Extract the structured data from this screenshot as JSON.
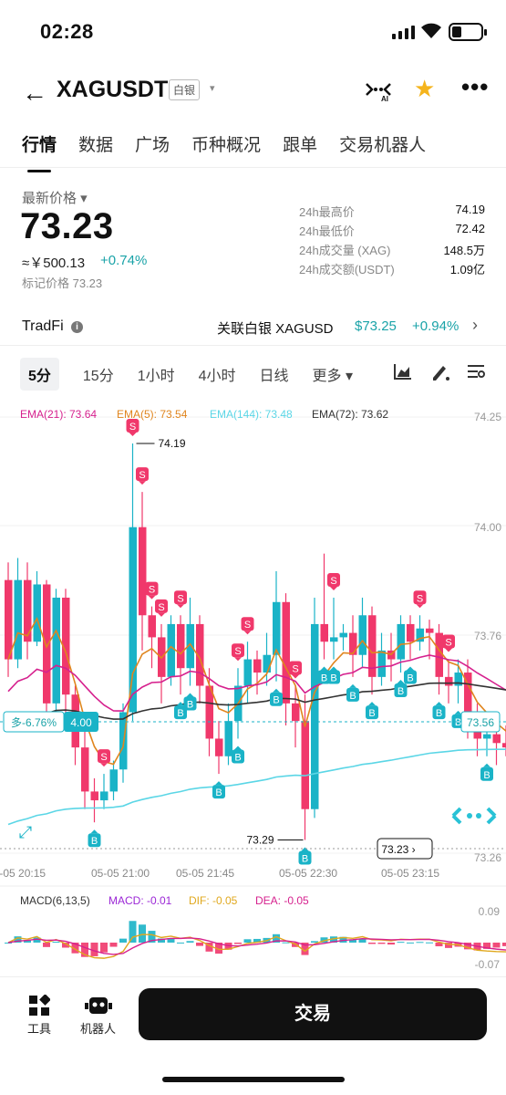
{
  "status_bar": {
    "time": "02:28"
  },
  "header": {
    "pair": "XAGUSDT",
    "tag": "白银",
    "caret": "▾",
    "ai_label": "AI"
  },
  "tabs": [
    "行情",
    "数据",
    "广场",
    "币种概况",
    "跟单",
    "交易机器人"
  ],
  "price": {
    "latest_label": "最新价格 ▾",
    "latest": "73.23",
    "cny": "≈￥500.13",
    "change_pct": "+0.74%",
    "mark": "标记价格 73.23"
  },
  "stats": [
    {
      "label": "24h最高价",
      "value": "74.19"
    },
    {
      "label": "24h最低价",
      "value": "72.42"
    },
    {
      "label": "24h成交量 (XAG)",
      "value": "148.5万"
    },
    {
      "label": "24h成交额(USDT)",
      "value": "1.09亿"
    }
  ],
  "tradfi": {
    "label": "TradFi",
    "linked": "关联白银 XAGUSD",
    "price": "$73.25",
    "pct": "+0.94%"
  },
  "intervals": [
    "5分",
    "15分",
    "1小时",
    "4小时",
    "日线",
    "更多 ▾"
  ],
  "chart_data": {
    "type": "candlestick",
    "ema_legend": [
      {
        "label": "EMA(21): 73.64",
        "color": "#d6218e"
      },
      {
        "label": "EMA(5): 73.54",
        "color": "#e0851e"
      },
      {
        "label": "EMA(144): 73.48",
        "color": "#5bd6e6"
      },
      {
        "label": "EMA(72): 73.62",
        "color": "#333333"
      }
    ],
    "y_ticks": [
      "74.25",
      "74.00",
      "73.76",
      "73.26"
    ],
    "x_ticks": [
      "05-05 20:15",
      "05-05 21:00",
      "05-05 21:45",
      "05-05 22:30",
      "05-05 23:15"
    ],
    "high_marker": "74.19",
    "low_marker": "73.29",
    "current_price_tag": "73.23",
    "right_price_tag": "73.56",
    "position_tag": {
      "label": "多-6.76%",
      "value": "4.00"
    },
    "candles": [
      [
        73.88,
        73.7,
        73.92,
        73.66
      ],
      [
        73.7,
        73.88,
        73.93,
        73.68
      ],
      [
        73.88,
        73.74,
        73.92,
        73.7
      ],
      [
        73.74,
        73.87,
        73.9,
        73.73
      ],
      [
        73.87,
        73.6,
        73.88,
        73.58
      ],
      [
        73.6,
        73.84,
        73.86,
        73.58
      ],
      [
        73.84,
        73.62,
        73.86,
        73.57
      ],
      [
        73.62,
        73.5,
        73.64,
        73.46
      ],
      [
        73.5,
        73.4,
        73.56,
        73.36
      ],
      [
        73.4,
        73.38,
        73.43,
        73.33
      ],
      [
        73.38,
        73.4,
        73.44,
        73.36
      ],
      [
        73.4,
        73.45,
        73.47,
        73.38
      ],
      [
        73.45,
        73.58,
        73.6,
        73.42
      ],
      [
        73.58,
        74.0,
        74.19,
        73.56
      ],
      [
        74.0,
        73.8,
        74.08,
        73.72
      ],
      [
        73.8,
        73.75,
        73.82,
        73.68
      ],
      [
        73.75,
        73.66,
        73.78,
        73.6
      ],
      [
        73.66,
        73.78,
        73.8,
        73.64
      ],
      [
        73.78,
        73.68,
        73.8,
        73.62
      ],
      [
        73.68,
        73.78,
        73.84,
        73.64
      ],
      [
        73.78,
        73.64,
        73.8,
        73.6
      ],
      [
        73.64,
        73.52,
        73.68,
        73.48
      ],
      [
        73.52,
        73.48,
        73.56,
        73.44
      ],
      [
        73.48,
        73.56,
        73.6,
        73.46
      ],
      [
        73.56,
        73.64,
        73.68,
        73.52
      ],
      [
        73.64,
        73.7,
        73.74,
        73.6
      ],
      [
        73.7,
        73.67,
        73.72,
        73.62
      ],
      [
        73.67,
        73.71,
        73.76,
        73.64
      ],
      [
        73.71,
        73.83,
        73.9,
        73.65
      ],
      [
        73.83,
        73.6,
        73.85,
        73.55
      ],
      [
        73.6,
        73.56,
        73.64,
        73.5
      ],
      [
        73.56,
        73.36,
        73.62,
        73.29
      ],
      [
        73.36,
        73.78,
        73.84,
        73.34
      ],
      [
        73.78,
        73.74,
        73.94,
        73.7
      ],
      [
        73.74,
        73.75,
        73.84,
        73.7
      ],
      [
        73.75,
        73.76,
        73.78,
        73.72
      ],
      [
        73.76,
        73.71,
        73.8,
        73.66
      ],
      [
        73.71,
        73.8,
        73.84,
        73.68
      ],
      [
        73.8,
        73.66,
        73.82,
        73.62
      ],
      [
        73.66,
        73.72,
        73.76,
        73.64
      ],
      [
        73.72,
        73.7,
        73.76,
        73.65
      ],
      [
        73.7,
        73.78,
        73.8,
        73.67
      ],
      [
        73.78,
        73.74,
        73.8,
        73.7
      ],
      [
        73.74,
        73.77,
        73.8,
        73.72
      ],
      [
        73.77,
        73.76,
        73.79,
        73.7
      ],
      [
        73.76,
        73.66,
        73.78,
        73.62
      ],
      [
        73.66,
        73.64,
        73.7,
        73.6
      ],
      [
        73.64,
        73.67,
        73.7,
        73.6
      ],
      [
        73.67,
        73.56,
        73.7,
        73.52
      ],
      [
        73.56,
        73.52,
        73.6,
        73.48
      ],
      [
        73.52,
        73.53,
        73.56,
        73.48
      ],
      [
        73.53,
        73.51,
        73.56,
        73.46
      ],
      [
        73.51,
        73.5,
        73.55,
        73.48
      ]
    ],
    "buy_markers": [
      9,
      18,
      19,
      22,
      24,
      28,
      31,
      33,
      34,
      36,
      38,
      41,
      42,
      45,
      47,
      50
    ],
    "sell_markers": [
      10,
      13,
      14,
      15,
      16,
      18,
      24,
      25,
      30,
      34,
      43,
      46
    ],
    "macd_legend": [
      {
        "label": "MACD(6,13,5)",
        "color": "#333333"
      },
      {
        "label": "MACD: -0.01",
        "color": "#9b27d6"
      },
      {
        "label": "DIF: -0.05",
        "color": "#e0a81e"
      },
      {
        "label": "DEA: -0.05",
        "color": "#d6218e"
      }
    ],
    "macd_ticks": [
      "0.09",
      "-0.07"
    ]
  },
  "bottom": {
    "tools": "工具",
    "robot": "机器人",
    "trade": "交易"
  }
}
